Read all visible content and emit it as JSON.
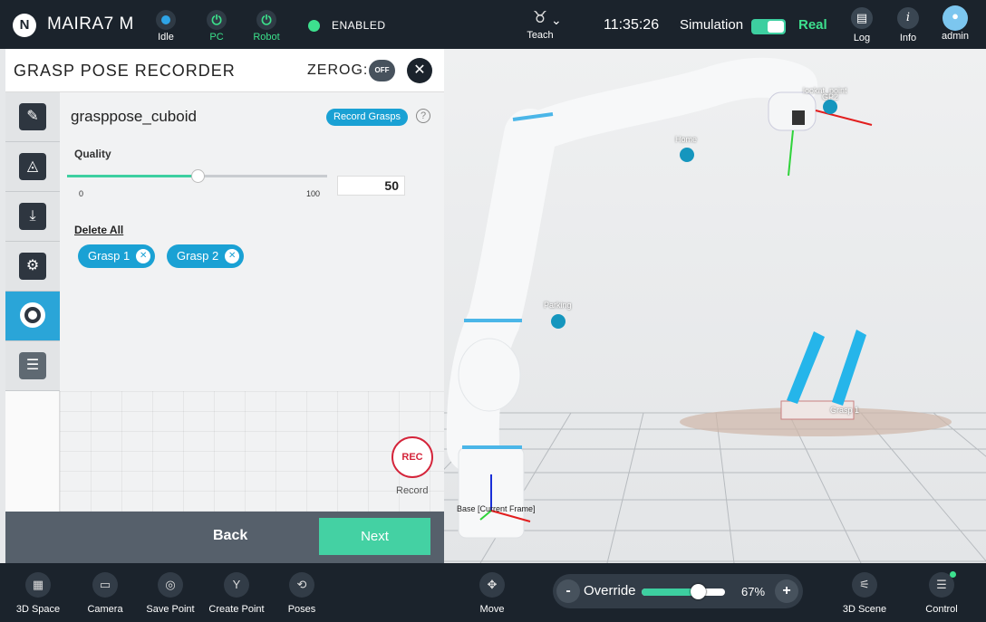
{
  "header": {
    "logo_letter": "N",
    "brand": "MAIRA7 M",
    "states": [
      {
        "label": "Idle",
        "icon": "status-dot-icon"
      },
      {
        "label": "PC",
        "icon": "power-icon"
      },
      {
        "label": "Robot",
        "icon": "power-icon"
      }
    ],
    "enabled_label": "ENABLED",
    "mode_label": "Teach",
    "time": "11:35:26",
    "simulation_label": "Simulation",
    "real_label": "Real",
    "right_buttons": [
      {
        "label": "Log",
        "icon": "log-icon"
      },
      {
        "label": "Info",
        "icon": "info-icon"
      },
      {
        "label": "admin",
        "icon": "user-avatar-icon"
      }
    ]
  },
  "panel": {
    "title": "GRASP POSE RECORDER",
    "zerog_label": "ZEROG:",
    "zerog_state": "OFF",
    "file_name": "grasppose_cuboid",
    "record_grasps_label": "Record Grasps",
    "help_label": "?",
    "quality": {
      "label": "Quality",
      "value": 50,
      "min": 0,
      "max": 100,
      "value_text": "50",
      "min_text": "0",
      "max_text": "100"
    },
    "delete_all_label": "Delete All",
    "grasps": [
      {
        "label": "Grasp 1"
      },
      {
        "label": "Grasp 2"
      }
    ],
    "rec_label": "REC",
    "record_label": "Record",
    "back_label": "Back",
    "next_label": "Next"
  },
  "sidebar": {
    "items": [
      {
        "name": "edit",
        "active": false
      },
      {
        "name": "scan-area",
        "active": false
      },
      {
        "name": "download",
        "active": false
      },
      {
        "name": "gripper",
        "active": false
      },
      {
        "name": "record",
        "active": true
      },
      {
        "name": "settings",
        "active": false
      }
    ]
  },
  "scene": {
    "labels": {
      "lookat": "lookat_point",
      "gp": "GP2",
      "home": "Home",
      "parking": "Parking",
      "grasp": "Grasp 1",
      "base": "Base [Current Frame]"
    }
  },
  "footer": {
    "left_buttons": [
      {
        "label": "3D Space",
        "icon": "3d-space-icon"
      },
      {
        "label": "Camera",
        "icon": "camera-icon"
      },
      {
        "label": "Save Point",
        "icon": "save-point-icon"
      },
      {
        "label": "Create Point",
        "icon": "create-point-icon"
      },
      {
        "label": "Poses",
        "icon": "poses-icon"
      }
    ],
    "move_label": "Move",
    "override": {
      "label": "Override",
      "value": 67,
      "value_text": "67%",
      "minus": "-",
      "plus": "+"
    },
    "right_buttons": [
      {
        "label": "3D Scene",
        "icon": "3d-scene-icon"
      },
      {
        "label": "Control",
        "icon": "control-icon"
      }
    ]
  },
  "colors": {
    "accent": "#1aa1d4",
    "green": "#3dcfa0",
    "dark": "#1b232c",
    "rec": "#d4243a"
  }
}
